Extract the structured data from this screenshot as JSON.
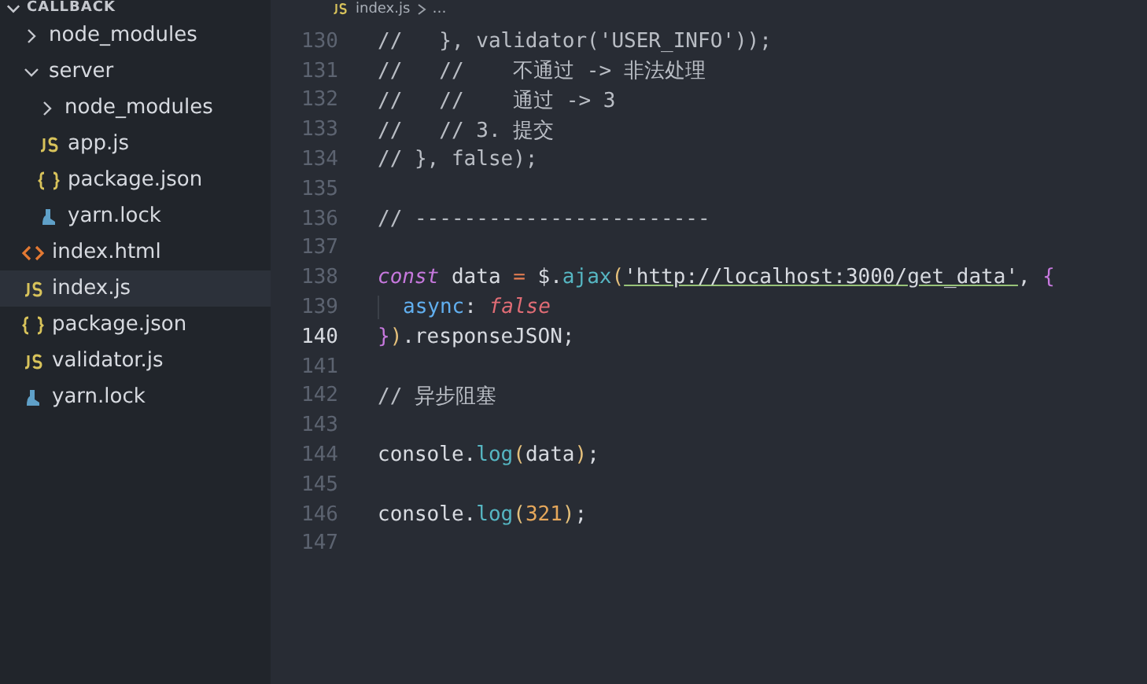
{
  "explorer": {
    "title": "CALLBACK",
    "items": [
      {
        "name": "node_modules",
        "kind": "folder",
        "expanded": false,
        "selected": false
      },
      {
        "name": "server",
        "kind": "folder",
        "expanded": true,
        "selected": false,
        "children": [
          {
            "name": "node_modules",
            "kind": "folder",
            "expanded": false,
            "selected": false
          },
          {
            "name": "app.js",
            "kind": "js",
            "selected": false
          },
          {
            "name": "package.json",
            "kind": "json",
            "selected": false
          },
          {
            "name": "yarn.lock",
            "kind": "yarn",
            "selected": false
          }
        ]
      },
      {
        "name": "index.html",
        "kind": "html",
        "selected": false
      },
      {
        "name": "index.js",
        "kind": "js",
        "selected": true
      },
      {
        "name": "package.json",
        "kind": "json",
        "selected": false
      },
      {
        "name": "validator.js",
        "kind": "js",
        "selected": false
      },
      {
        "name": "yarn.lock",
        "kind": "yarn",
        "selected": false
      }
    ]
  },
  "breadcrumb": {
    "file": "index.js",
    "more": "…"
  },
  "editor": {
    "lines": [
      {
        "number": "130",
        "current": false,
        "tokens": [
          {
            "kind": "comment",
            "text": "//   }, validator('USER_INFO'));"
          }
        ]
      },
      {
        "number": "131",
        "current": false,
        "tokens": [
          {
            "kind": "comment",
            "text": "//   //    不通过 -> 非法处理"
          }
        ]
      },
      {
        "number": "132",
        "current": false,
        "tokens": [
          {
            "kind": "comment",
            "text": "//   //    通过 -> 3"
          }
        ]
      },
      {
        "number": "133",
        "current": false,
        "tokens": [
          {
            "kind": "comment",
            "text": "//   // 3. 提交"
          }
        ]
      },
      {
        "number": "134",
        "current": false,
        "tokens": [
          {
            "kind": "comment",
            "text": "// }, false);"
          }
        ]
      },
      {
        "number": "135",
        "current": false
      },
      {
        "number": "136",
        "current": false,
        "tokens": [
          {
            "kind": "comment",
            "text": "// ------------------------"
          }
        ]
      },
      {
        "number": "137",
        "current": false
      },
      {
        "number": "138",
        "current": false,
        "tokens": [
          {
            "kind": "keyword",
            "text": "const"
          },
          {
            "kind": "plain",
            "text": " data "
          },
          {
            "kind": "operator",
            "text": "="
          },
          {
            "kind": "plain",
            "text": " $."
          },
          {
            "kind": "function",
            "text": "ajax"
          },
          {
            "kind": "bracket",
            "text": "("
          },
          {
            "kind": "string",
            "text": "'http://localhost:3000/get_data'"
          },
          {
            "kind": "plain",
            "text": ", "
          },
          {
            "kind": "brace",
            "text": "{"
          }
        ]
      },
      {
        "number": "139",
        "current": false,
        "indented": true,
        "tokens": [
          {
            "kind": "property",
            "text": "async"
          },
          {
            "kind": "plain",
            "text": ": "
          },
          {
            "kind": "boolean",
            "text": "false"
          }
        ]
      },
      {
        "number": "140",
        "current": true,
        "tokens": [
          {
            "kind": "brace",
            "text": "}"
          },
          {
            "kind": "bracket",
            "text": ")"
          },
          {
            "kind": "plain",
            "text": ".responseJSON;"
          }
        ]
      },
      {
        "number": "141",
        "current": false
      },
      {
        "number": "142",
        "current": false,
        "tokens": [
          {
            "kind": "comment",
            "text": "// 异步阻塞"
          }
        ]
      },
      {
        "number": "143",
        "current": false
      },
      {
        "number": "144",
        "current": false,
        "tokens": [
          {
            "kind": "plain",
            "text": "console."
          },
          {
            "kind": "function",
            "text": "log"
          },
          {
            "kind": "bracket",
            "text": "("
          },
          {
            "kind": "plain",
            "text": "data"
          },
          {
            "kind": "bracket",
            "text": ")"
          },
          {
            "kind": "plain",
            "text": ";"
          }
        ]
      },
      {
        "number": "145",
        "current": false
      },
      {
        "number": "146",
        "current": false,
        "tokens": [
          {
            "kind": "plain",
            "text": "console."
          },
          {
            "kind": "function",
            "text": "log"
          },
          {
            "kind": "bracket",
            "text": "("
          },
          {
            "kind": "number",
            "text": "321"
          },
          {
            "kind": "bracket",
            "text": ")"
          },
          {
            "kind": "plain",
            "text": ";"
          }
        ]
      },
      {
        "number": "147",
        "current": false
      }
    ]
  }
}
